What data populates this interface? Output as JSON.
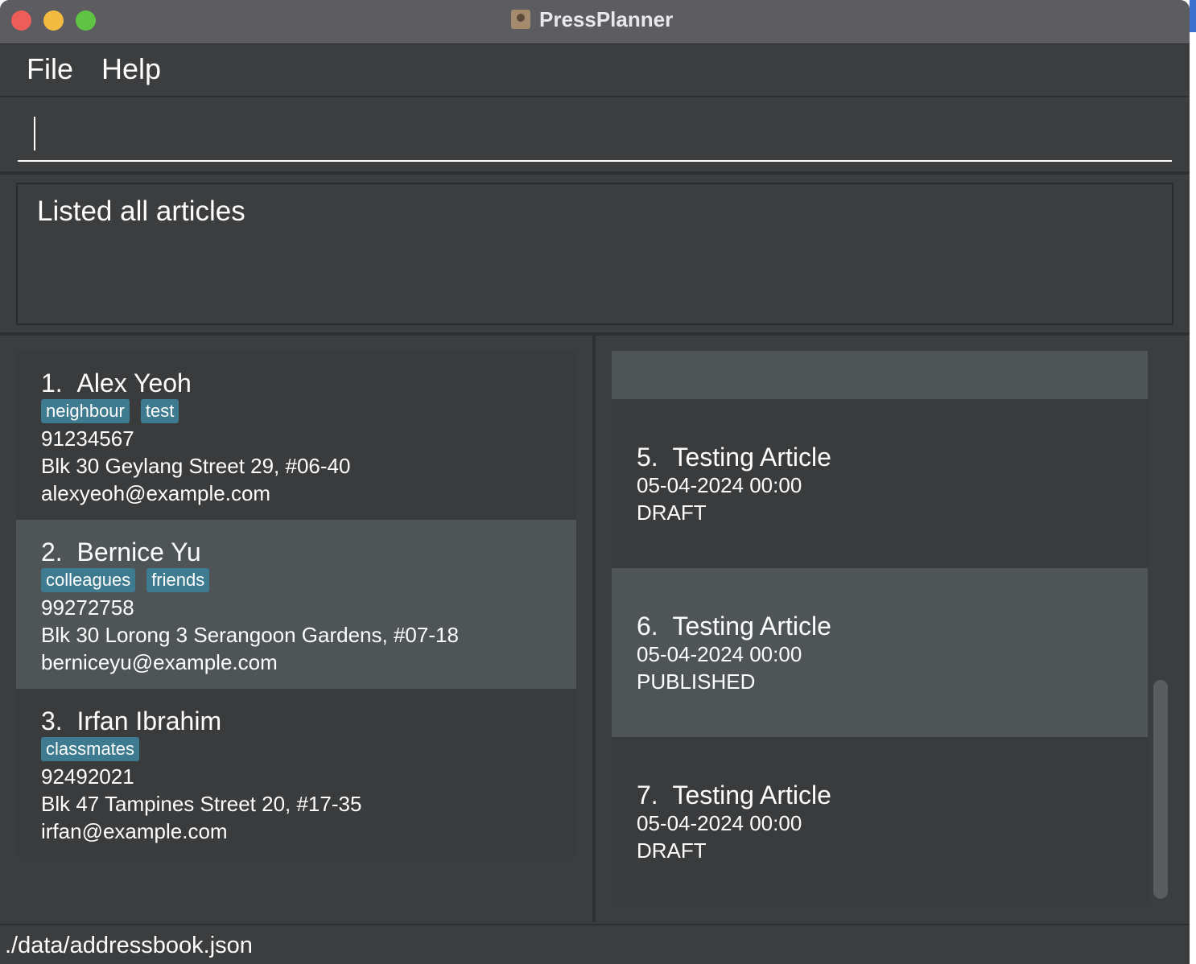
{
  "window": {
    "title": "PressPlanner"
  },
  "menu": {
    "file": "File",
    "help": "Help"
  },
  "command": {
    "value": "",
    "placeholder": ""
  },
  "result": {
    "message": "Listed all articles"
  },
  "persons": [
    {
      "index": "1.",
      "name": "Alex Yeoh",
      "tags": [
        "neighbour",
        "test"
      ],
      "phone": "91234567",
      "address": "Blk 30 Geylang Street 29, #06-40",
      "email": "alexyeoh@example.com"
    },
    {
      "index": "2.",
      "name": "Bernice Yu",
      "tags": [
        "colleagues",
        "friends"
      ],
      "phone": "99272758",
      "address": "Blk 30 Lorong 3 Serangoon Gardens, #07-18",
      "email": "berniceyu@example.com"
    },
    {
      "index": "3.",
      "name": "Irfan Ibrahim",
      "tags": [
        "classmates"
      ],
      "phone": "92492021",
      "address": "Blk 47 Tampines Street 20, #17-35",
      "email": "irfan@example.com"
    }
  ],
  "articles": [
    {
      "index": "5.",
      "title": "Testing Article",
      "date": "05-04-2024 00:00",
      "status": "DRAFT"
    },
    {
      "index": "6.",
      "title": "Testing Article",
      "date": "05-04-2024 00:00",
      "status": "PUBLISHED"
    },
    {
      "index": "7.",
      "title": "Testing Article",
      "date": "05-04-2024 00:00",
      "status": "DRAFT"
    }
  ],
  "status_bar": {
    "path": "./data/addressbook.json"
  },
  "colors": {
    "background": "#3a3b3c",
    "selected": "#4f5456",
    "tag": "#3e7b91",
    "titlebar": "#5d5c61"
  },
  "icons": {
    "app": "address-book-icon"
  }
}
